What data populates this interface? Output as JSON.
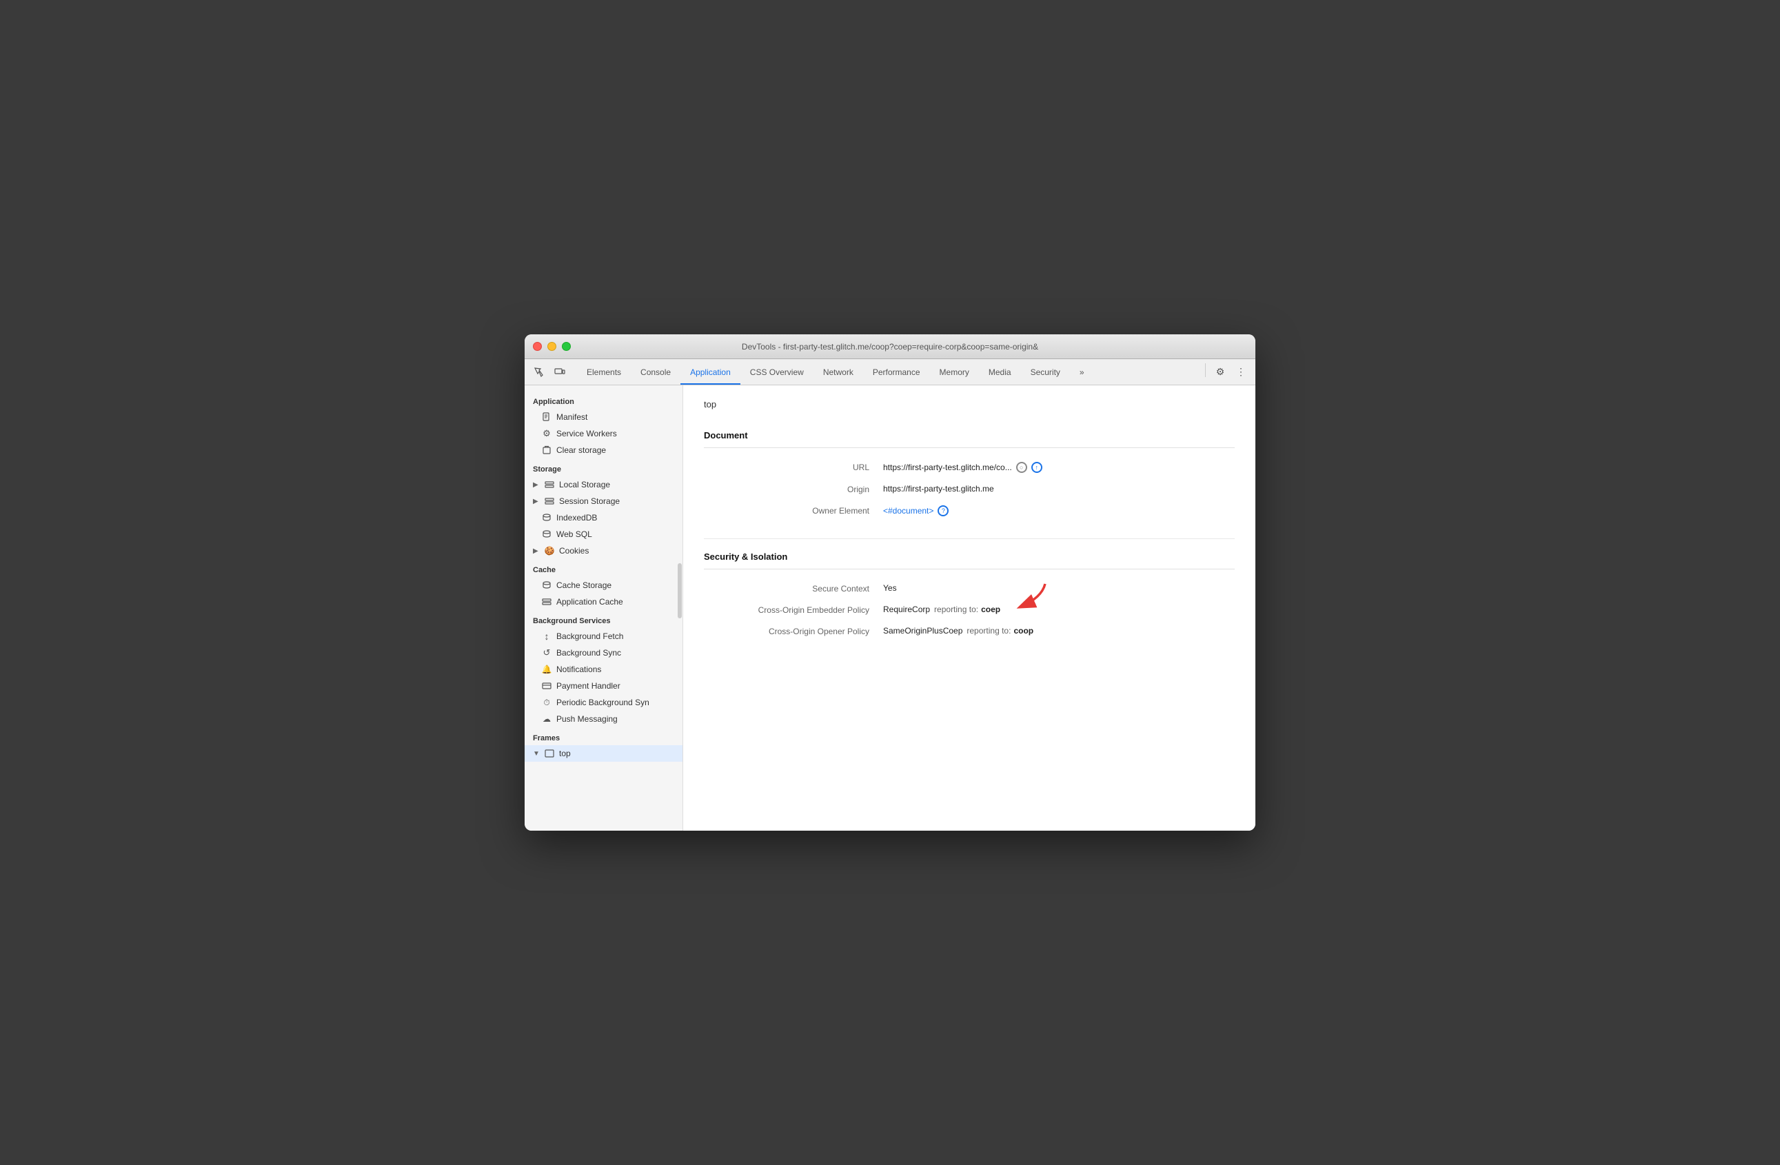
{
  "window": {
    "title": "DevTools - first-party-test.glitch.me/coop?coep=require-corp&coop=same-origin&"
  },
  "toolbar": {
    "tabs": [
      {
        "id": "elements",
        "label": "Elements",
        "active": false
      },
      {
        "id": "console",
        "label": "Console",
        "active": false
      },
      {
        "id": "application",
        "label": "Application",
        "active": true
      },
      {
        "id": "css-overview",
        "label": "CSS Overview",
        "active": false
      },
      {
        "id": "network",
        "label": "Network",
        "active": false
      },
      {
        "id": "performance",
        "label": "Performance",
        "active": false
      },
      {
        "id": "memory",
        "label": "Memory",
        "active": false
      },
      {
        "id": "media",
        "label": "Media",
        "active": false
      },
      {
        "id": "security",
        "label": "Security",
        "active": false
      }
    ]
  },
  "sidebar": {
    "sections": [
      {
        "id": "application",
        "header": "Application",
        "items": [
          {
            "id": "manifest",
            "label": "Manifest",
            "icon": "📄",
            "indent": 1
          },
          {
            "id": "service-workers",
            "label": "Service Workers",
            "icon": "⚙",
            "indent": 1
          },
          {
            "id": "clear-storage",
            "label": "Clear storage",
            "icon": "🗑",
            "indent": 1
          }
        ]
      },
      {
        "id": "storage",
        "header": "Storage",
        "items": [
          {
            "id": "local-storage",
            "label": "Local Storage",
            "icon": "⊞",
            "indent": 1,
            "arrow": "▶"
          },
          {
            "id": "session-storage",
            "label": "Session Storage",
            "icon": "⊞",
            "indent": 1,
            "arrow": "▶"
          },
          {
            "id": "indexed-db",
            "label": "IndexedDB",
            "icon": "🗄",
            "indent": 1
          },
          {
            "id": "web-sql",
            "label": "Web SQL",
            "icon": "🗄",
            "indent": 1
          },
          {
            "id": "cookies",
            "label": "Cookies",
            "icon": "🍪",
            "indent": 1,
            "arrow": "▶"
          }
        ]
      },
      {
        "id": "cache",
        "header": "Cache",
        "items": [
          {
            "id": "cache-storage",
            "label": "Cache Storage",
            "icon": "🗄",
            "indent": 1
          },
          {
            "id": "application-cache",
            "label": "Application Cache",
            "icon": "⊞",
            "indent": 1
          }
        ]
      },
      {
        "id": "background-services",
        "header": "Background Services",
        "items": [
          {
            "id": "background-fetch",
            "label": "Background Fetch",
            "icon": "↕",
            "indent": 1
          },
          {
            "id": "background-sync",
            "label": "Background Sync",
            "icon": "↺",
            "indent": 1
          },
          {
            "id": "notifications",
            "label": "Notifications",
            "icon": "🔔",
            "indent": 1
          },
          {
            "id": "payment-handler",
            "label": "Payment Handler",
            "icon": "▭",
            "indent": 1
          },
          {
            "id": "periodic-background-sync",
            "label": "Periodic Background Syn",
            "icon": "⏱",
            "indent": 1
          },
          {
            "id": "push-messaging",
            "label": "Push Messaging",
            "icon": "☁",
            "indent": 1
          }
        ]
      },
      {
        "id": "frames",
        "header": "Frames",
        "items": [
          {
            "id": "top-frame",
            "label": "top",
            "icon": "▭",
            "indent": 1,
            "arrow": "▼",
            "selected": true
          }
        ]
      }
    ]
  },
  "main": {
    "page_title": "top",
    "sections": [
      {
        "id": "document",
        "header": "Document",
        "fields": [
          {
            "id": "url",
            "label": "URL",
            "value": "https://first-party-test.glitch.me/co...",
            "has_icons": true
          },
          {
            "id": "origin",
            "label": "Origin",
            "value": "https://first-party-test.glitch.me"
          },
          {
            "id": "owner-element",
            "label": "Owner Element",
            "value": "<#document>",
            "is_link": true,
            "has_circle_icon": true
          }
        ]
      },
      {
        "id": "security-isolation",
        "header": "Security & Isolation",
        "fields": [
          {
            "id": "secure-context",
            "label": "Secure Context",
            "value": "Yes"
          },
          {
            "id": "coep",
            "label": "Cross-Origin Embedder Policy",
            "value": "RequireCorp",
            "reporting_label": "reporting to:",
            "reporting_value": "coep",
            "has_red_arrow": true
          },
          {
            "id": "coop",
            "label": "Cross-Origin Opener Policy",
            "value": "SameOriginPlusCoep",
            "reporting_label": "reporting to:",
            "reporting_value": "coop"
          }
        ]
      }
    ]
  }
}
